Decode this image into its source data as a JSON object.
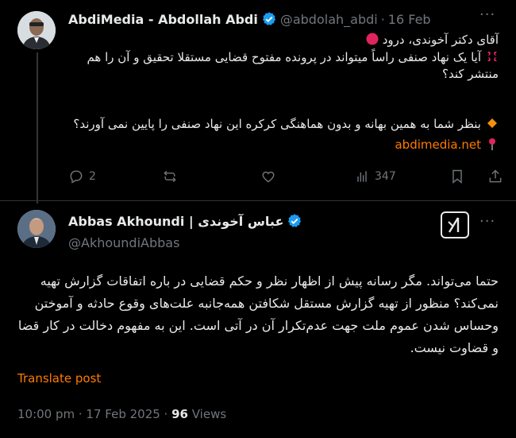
{
  "first_post": {
    "display_name": "AbdiMedia - Abdollah Abdi",
    "handle": "@abdolah_abdi",
    "date": "16 Feb",
    "more": "···",
    "line1": "آقای دکتر آخوندی، درود",
    "line2": "آیا یک نهاد صنفی راساً میتواند در پرونده مفتوح قضایی مستقلا تحقیق و آن را هم منتشر کند؟",
    "line3": "بنظر شما به همین بهانه و بدون هماهنگی کرکره این نهاد صنفی را پایین نمی آورند؟",
    "link": "abdimedia.net",
    "icons": {
      "line1": "red-circle-icon",
      "line2": "anger-symbol-icon",
      "line3": "orange-diamond-icon",
      "link": "round-pushpin-icon"
    },
    "actions": {
      "replies": "2",
      "retweets": "",
      "likes": "",
      "views": "347"
    }
  },
  "second_post": {
    "display_name": "Abbas Akhoundi | عباس آخوندی",
    "handle": "@AkhoundiAbbas",
    "body": "حتما می‌تواند. مگر رسانه پیش از اظهار نظر و حکم قضایی در باره اتفاقات گزارش تهیه نمی‌کند؟ منظور از تهیه گزارش مستقل شکافتن همه‌جانبه علت‌های وقوع حادثه و آموختن وحساس شدن عموم ملت جهت عدم‌تکرار آن در آتی است. این به مفهوم دخالت در کار قضا و قضاوت نیست.",
    "translate": "Translate post",
    "time": "10:00 pm · 17 Feb 2025 · ",
    "views_count": "96",
    "views_label": " Views"
  },
  "colors": {
    "background": "#000000",
    "text": "#e7e9ea",
    "secondary": "#71767b",
    "verified": "#1d9bf0",
    "link": "#ff7a00"
  }
}
